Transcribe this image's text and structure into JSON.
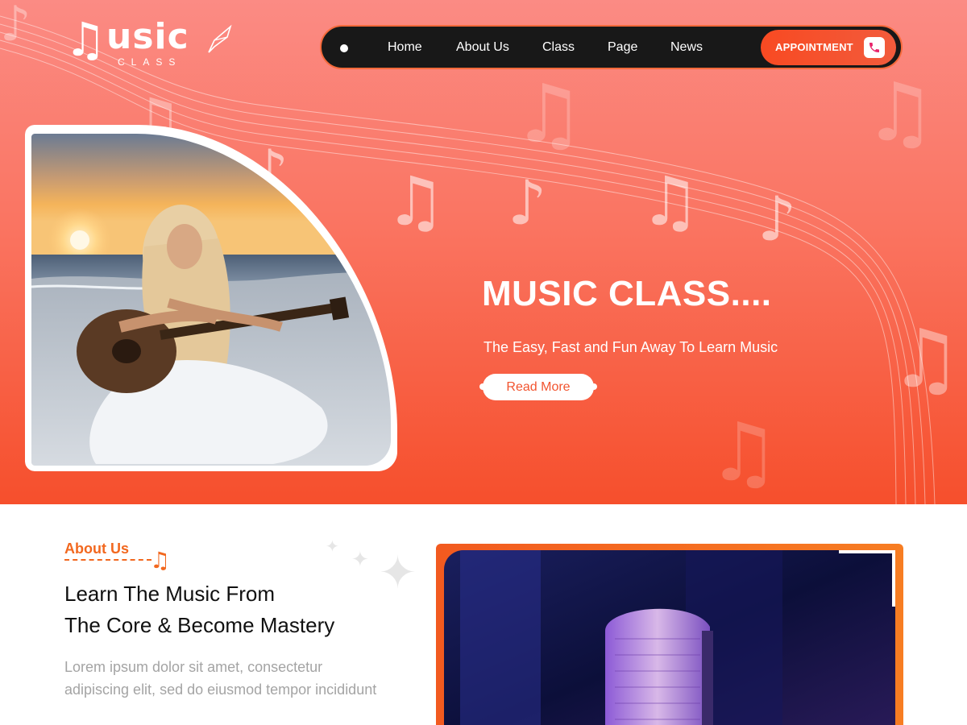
{
  "logo": {
    "word": "usic",
    "subtitle": "CLASS"
  },
  "nav": {
    "items": [
      "Home",
      "About Us",
      "Class",
      "Page",
      "News"
    ],
    "appointment_label": "APPOINTMENT",
    "colors": {
      "bar": "#181818",
      "accent": "#f84a22"
    }
  },
  "hero": {
    "title": "MUSIC CLASS....",
    "subtitle": "The Easy, Fast and Fun Away To Learn Music",
    "cta": "Read More",
    "colors": {
      "top": "#fb8b84",
      "bottom": "#f64f2c"
    }
  },
  "about": {
    "label": "About Us",
    "heading_line1": "Learn The Music From",
    "heading_line2": "The Core & Become Mastery",
    "text_line1": "Lorem ipsum dolor sit amet, consectetur",
    "text_line2": "adipiscing elit, sed do eiusmod tempor incididunt"
  },
  "icons": {
    "logo": "music-note-icon",
    "phone": "phone-icon",
    "about": "music-note-icon",
    "decor": "sparkle-icon"
  }
}
